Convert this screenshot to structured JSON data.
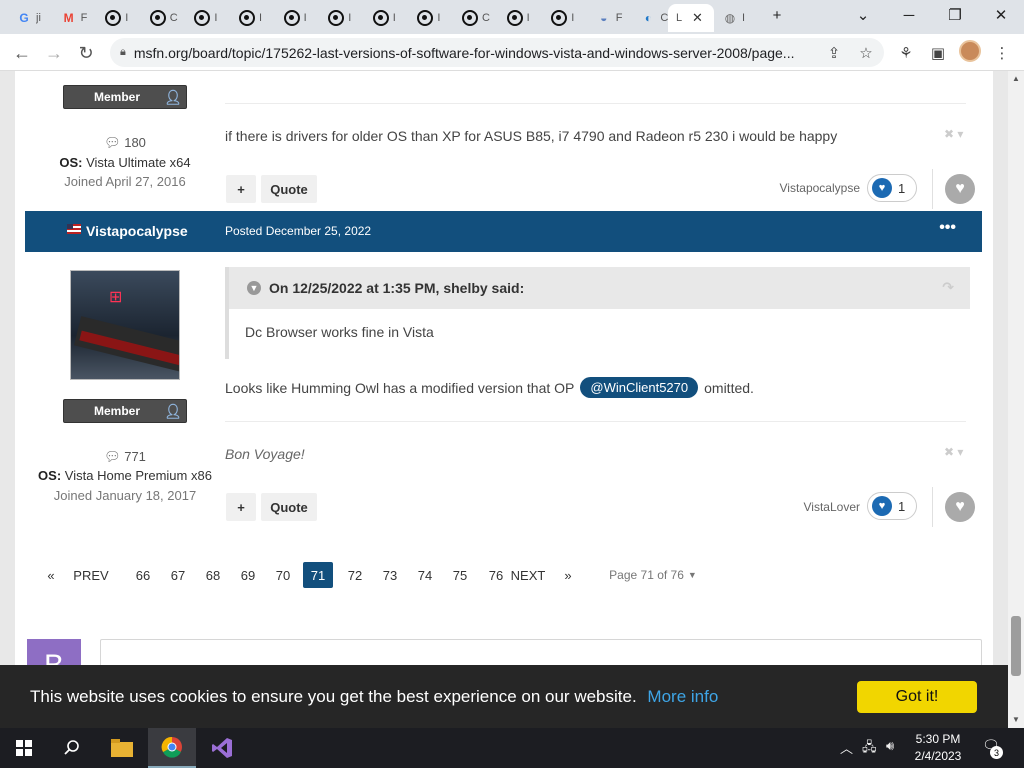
{
  "browser": {
    "tabs": [
      {
        "icon": "google-icon",
        "glyph": "G",
        "label": "ji",
        "color": "#4285F4"
      },
      {
        "icon": "gmail-icon",
        "glyph": "M",
        "label": "F",
        "color": "#EA4335"
      },
      {
        "icon": "ring-icon",
        "glyph": "",
        "label": "I"
      },
      {
        "icon": "ring-icon",
        "glyph": "",
        "label": "C"
      },
      {
        "icon": "ring-icon",
        "glyph": "",
        "label": "I"
      },
      {
        "icon": "ring-icon",
        "glyph": "",
        "label": "I"
      },
      {
        "icon": "ring-icon",
        "glyph": "",
        "label": "I"
      },
      {
        "icon": "ring-icon",
        "glyph": "",
        "label": "I"
      },
      {
        "icon": "ring-icon",
        "glyph": "",
        "label": "I"
      },
      {
        "icon": "ring-icon",
        "glyph": "",
        "label": "I"
      },
      {
        "icon": "ring-icon",
        "glyph": "",
        "label": "C"
      },
      {
        "icon": "ring-icon",
        "glyph": "",
        "label": "I"
      },
      {
        "icon": "ring-icon",
        "glyph": "",
        "label": "I"
      },
      {
        "icon": "shield-icon",
        "glyph": "◒",
        "label": "F",
        "color": "#5b7fbf"
      },
      {
        "icon": "edge-icon",
        "glyph": "◐",
        "label": "C",
        "color": "#1f78c8"
      }
    ],
    "active_tab_label": "L",
    "last_tab_label": "I",
    "url": "msfn.org/board/topic/175262-last-versions-of-software-for-windows-vista-and-windows-server-2008/page..."
  },
  "posts": [
    {
      "badge": "Member",
      "post_count": "180",
      "os_label": "OS:",
      "os": "Vista Ultimate x64",
      "joined": "Joined April 27, 2016",
      "content": "if there is drivers for older OS than XP for ASUS B85, i7 4790 and Radeon r5 230 i would be happy",
      "quote_label": "Quote",
      "plus": "+",
      "reactor": "Vistapocalypse",
      "reaction_count": "1"
    },
    {
      "author": "Vistapocalypse",
      "posted": "Posted December 25, 2022",
      "more": "•••",
      "badge": "Member",
      "post_count": "771",
      "os_label": "OS:",
      "os": "Vista Home Premium x86",
      "joined": "Joined January 18, 2017",
      "quote_header": "On 12/25/2022 at 1:35 PM, shelby said:",
      "quote_body": "Dc Browser works fine in Vista",
      "content_before": "Looks like Humming Owl has a modified version that OP",
      "mention": "@WinClient5270",
      "content_after": "omitted.",
      "signature": "Bon Voyage!",
      "quote_label": "Quote",
      "plus": "+",
      "reactor": "VistaLover",
      "reaction_count": "1"
    }
  ],
  "pagination": {
    "first": "«",
    "prev": "PREV",
    "pages": [
      "66",
      "67",
      "68",
      "69",
      "70",
      "71",
      "72",
      "73",
      "74",
      "75",
      "76"
    ],
    "current": "71",
    "next": "NEXT",
    "last": "»",
    "page_of": "Page 71 of 76"
  },
  "reply_avatar_letter": "B",
  "cookie": {
    "text": "This website uses cookies to ensure you get the best experience on our website.",
    "more": "More info",
    "button": "Got it!"
  },
  "taskbar": {
    "time": "5:30 PM",
    "date": "2/4/2023",
    "notifications": "3"
  },
  "colors": {
    "accent": "#124f7d",
    "cookie_button": "#f1d600",
    "cookie_link": "#3ea5e6"
  }
}
